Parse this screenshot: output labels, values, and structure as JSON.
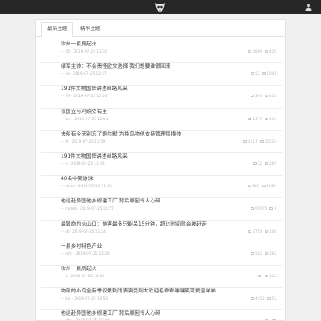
{
  "header": {
    "logo": "monkey-face-logo",
    "user_icon": "user-icon"
  },
  "tabs": [
    {
      "label": "最新主题"
    },
    {
      "label": "精华主题"
    }
  ],
  "items": [
    {
      "title": "钦州一民房起火",
      "meta": "··· 05 · 2019-07-24 13:02",
      "views": "3669",
      "replies": "426"
    },
    {
      "title": "绿军主帅：不会责怪欧文选择 我们想要谁很回来",
      "meta": "··· vs · 2019-07-25 12:57",
      "views": "53",
      "replies": "1941"
    },
    {
      "title": "191件文物国博讲述丝路风采",
      "meta": "··· 79 · 2019-07-25 12:56",
      "views": "394",
      "replies": "450"
    },
    {
      "title": "张国立与冯婉安有生",
      "meta": "··· tvs · 2019-07-25 12:54",
      "views": "1477",
      "replies": "443"
    },
    {
      "title": "快船有今天别忘了鲍尔默 为换鸟物他支持管理层换帅",
      "meta": "··· tt · 2019-07-25 11:59",
      "views": "4117",
      "replies": "15524"
    },
    {
      "title": "191件文物国博讲述丝路风采",
      "meta": "··· v · 2019-07-25 11:59",
      "views": "12",
      "replies": "269"
    },
    {
      "title": "40名中美游泳",
      "meta": "··· dtcm · 2019-07-25 11:59",
      "views": "867",
      "replies": "1084"
    },
    {
      "title": "他远赴异国他乡修建工厂 背后原因令人心碎",
      "meta": "··· cedeb · 2019-07-25 11:57",
      "views": "09075",
      "replies": "1"
    },
    {
      "title": "最致命的火山口：游客最多只能呆15分钟，超过时间就会被赶走",
      "meta": "··· dl · 2019-07-25 11:24",
      "views": "3750",
      "replies": "106"
    },
    {
      "title": "一县乡村特色产业",
      "meta": "··· nhc · 2019-07-25 11:26",
      "views": "582",
      "replies": "262"
    },
    {
      "title": "钦州一民房起火",
      "meta": "··· c · 2019-07-25 10:51",
      "views": "",
      "replies": "122"
    },
    {
      "title": "物部的小鸟全新季驭戴刺戏表演受到大欢迎毛乖乖嘿嘿笑可爱温弟弟",
      "meta": "··· kol · 2019-07-25 10:50",
      "views": "4452",
      "replies": "52"
    },
    {
      "title": "他远赴异国他乡修建工厂 背后原因令人心碎",
      "meta": "··· dhs · 2019-07-25 10:44",
      "views": "",
      "replies": ""
    }
  ],
  "colors": {
    "topbar": "#272727",
    "text": "#333333",
    "meta": "#b3b3b3"
  }
}
